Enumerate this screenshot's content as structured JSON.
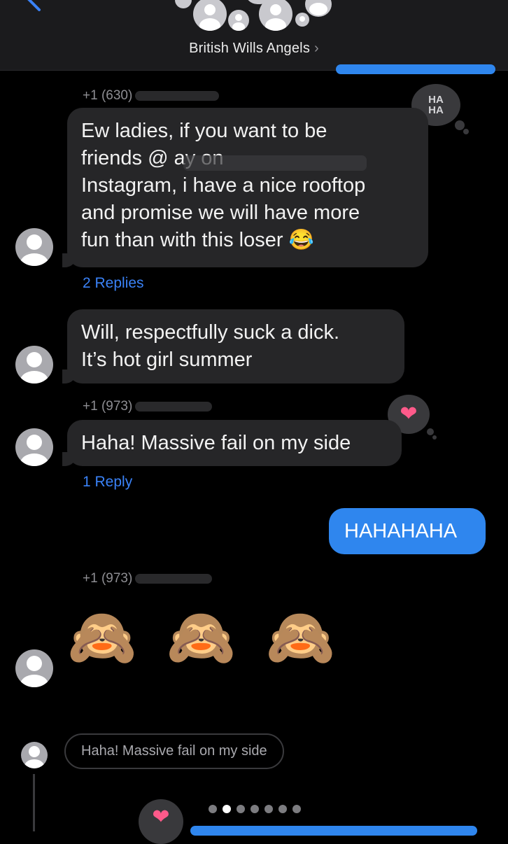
{
  "header": {
    "group_name": "British Wills Angels",
    "chevron": "›",
    "back_icon": "chevron-left-icon"
  },
  "messages": [
    {
      "sender": "+1 (630)",
      "text": "Ew ladies, if you want to be\nfriends @           ay on\nInstagram, i have a nice rooftop\nand promise we will have more\nfun than with this loser 😂",
      "replies": "2 Replies",
      "tapback": "HA\nHA"
    },
    {
      "text": "Will, respectfully suck a dick.\nIt’s hot girl summer"
    },
    {
      "sender": "+1 (973)",
      "text": "Haha! Massive fail on my side",
      "replies": "1 Reply",
      "tapback": "❤"
    },
    {
      "outgoing": true,
      "text": "HAHAHAHA"
    },
    {
      "sender": "+1 (973)",
      "emoji": "🙈 🙈 🙈"
    }
  ],
  "reply_quote": "Haha! Massive fail on my side",
  "bottom_tapback": "❤",
  "colors": {
    "background": "#000000",
    "incoming_bubble": "#262628",
    "outgoing_bubble": "#2f86ee",
    "link": "#3a82f7",
    "heart": "#fe5a8a"
  },
  "pagination": {
    "count": 7,
    "active_index": 1
  }
}
